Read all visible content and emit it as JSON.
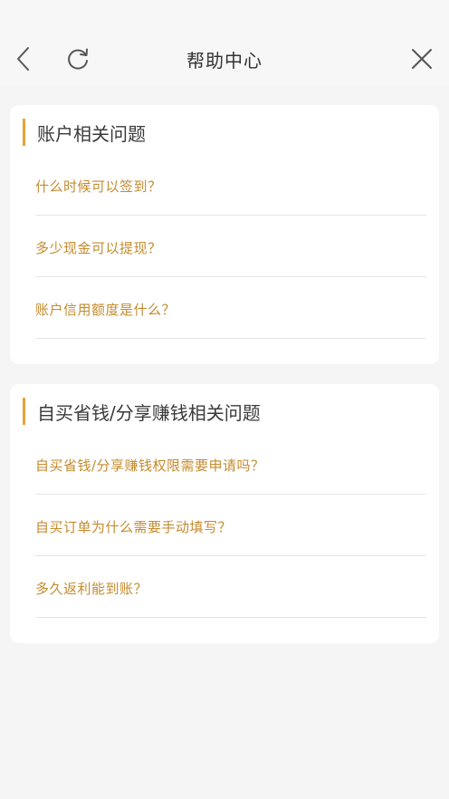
{
  "nav": {
    "title": "帮助中心",
    "back_icon": "chevron-left-icon",
    "refresh_icon": "refresh-icon",
    "close_icon": "close-icon"
  },
  "colors": {
    "accent": "#e8a13a",
    "link": "#c48b2e",
    "title": "#3a3a3a"
  },
  "sections": [
    {
      "title": "账户相关问题",
      "items": [
        "什么时候可以签到？",
        "多少现金可以提现？",
        "账户信用额度是什么？"
      ]
    },
    {
      "title": "自买省钱/分享赚钱相关问题",
      "items": [
        "自买省钱/分享赚钱权限需要申请吗？",
        "自买订单为什么需要手动填写？",
        "多久返利能到账？"
      ]
    }
  ]
}
